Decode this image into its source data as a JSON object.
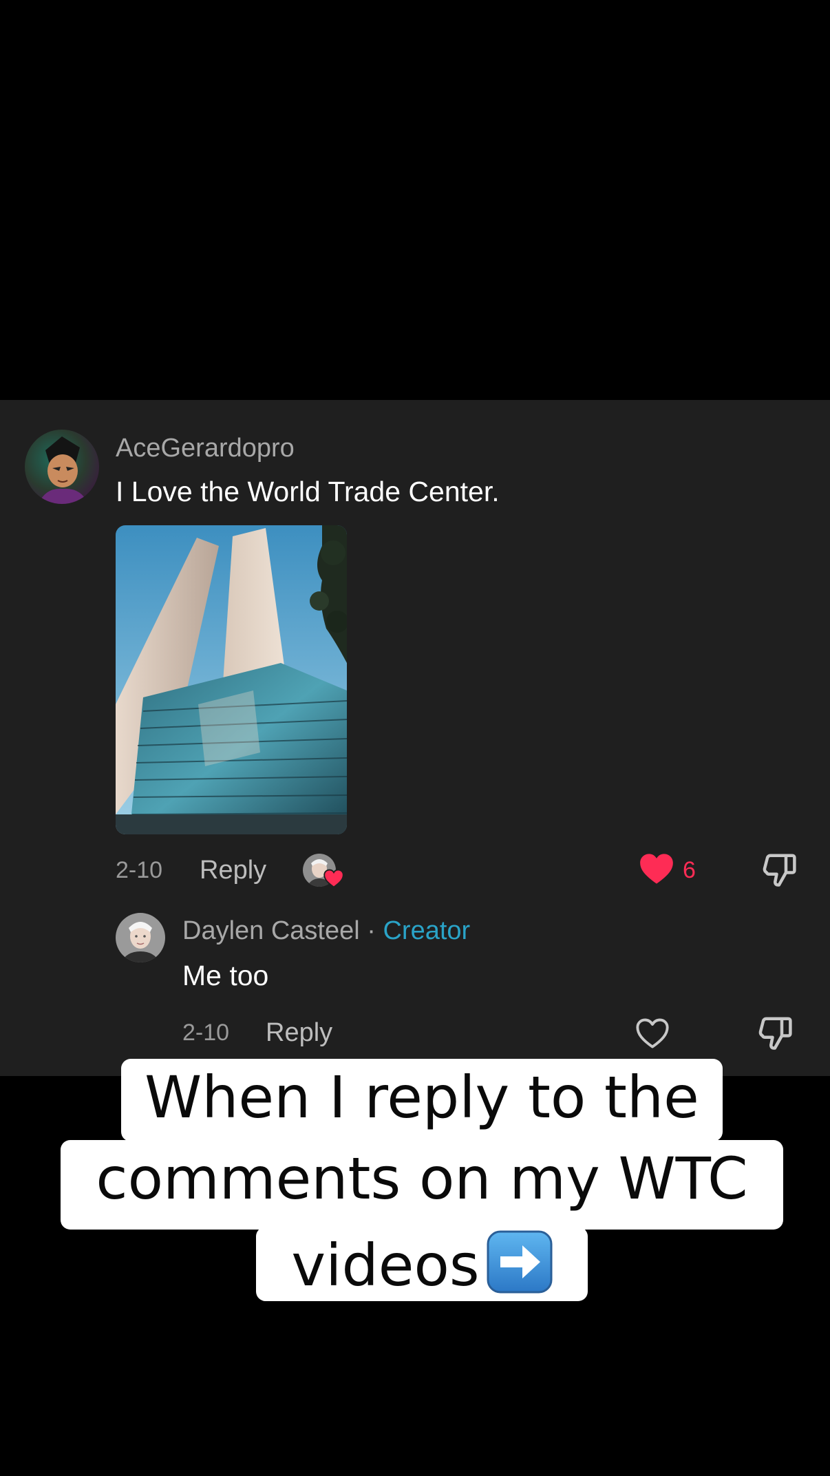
{
  "comment": {
    "username": "AceGerardopro",
    "text": "I Love the World Trade Center.",
    "date": "2-10",
    "reply_label": "Reply",
    "like_count": "6",
    "liked": true,
    "liked_by_creator": true
  },
  "reply": {
    "username": "Daylen Casteel",
    "separator": "·",
    "badge": "Creator",
    "text": "Me too",
    "date": "2-10",
    "reply_label": "Reply",
    "liked": false
  },
  "caption": {
    "line1": "When I reply to the",
    "line2": "comments on my WTC",
    "line3": "videos",
    "emoji": "arrow-right-emoji"
  },
  "colors": {
    "panel_bg": "#1f1f1f",
    "like_red": "#fe2c55",
    "creator_blue": "#2aa3c7",
    "caption_bg": "#ffffff"
  },
  "icons": {
    "like_filled": "heart-filled-icon",
    "like_outline": "heart-outline-icon",
    "dislike": "thumbs-down-icon"
  }
}
